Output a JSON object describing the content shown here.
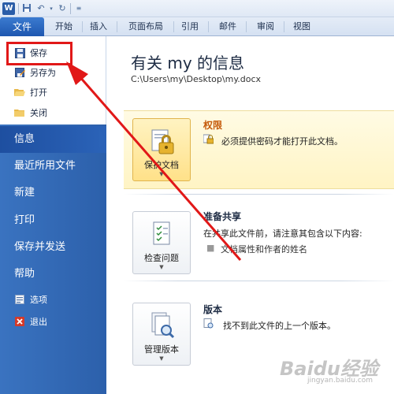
{
  "qat": {
    "word_logo": "W"
  },
  "tabs": {
    "file": "文件",
    "items": [
      "开始",
      "插入",
      "页面布局",
      "引用",
      "邮件",
      "审阅",
      "视图"
    ]
  },
  "left": {
    "small_items": [
      {
        "label": "保存",
        "icon": "save-icon"
      },
      {
        "label": "另存为",
        "icon": "save-as-icon"
      },
      {
        "label": "打开",
        "icon": "open-folder-icon"
      },
      {
        "label": "关闭",
        "icon": "close-folder-icon"
      }
    ],
    "big_items": [
      "信息",
      "最近所用文件",
      "新建",
      "打印",
      "保存并发送",
      "帮助"
    ],
    "active": "信息",
    "bottom_items": [
      {
        "label": "选项",
        "icon": "options-icon"
      },
      {
        "label": "退出",
        "icon": "exit-icon"
      }
    ]
  },
  "info": {
    "title": "有关 my 的信息",
    "path": "C:\\Users\\my\\Desktop\\my.docx"
  },
  "sections": {
    "permissions": {
      "button": "保护文档",
      "heading": "权限",
      "text": "必须提供密码才能打开此文档。"
    },
    "prepare": {
      "button": "检查问题",
      "heading": "准备共享",
      "text": "在共享此文件前，请注意其包含以下内容:",
      "bullet": "文档属性和作者的姓名"
    },
    "versions": {
      "button": "管理版本",
      "heading": "版本",
      "text": "找不到此文件的上一个版本。"
    }
  },
  "watermark": {
    "main": "Baidu经验",
    "sub": "jingyan.baidu.com"
  },
  "colors": {
    "accent_blue": "#2b63b8",
    "highlight_red": "#e11818",
    "permission_orange": "#c55a0a"
  }
}
